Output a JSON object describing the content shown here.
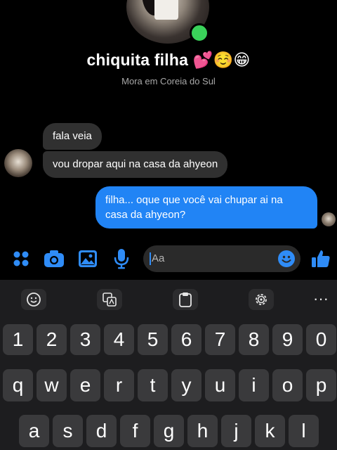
{
  "header": {
    "contact_name": "chiquita filha",
    "name_emojis": "💕☺️😁",
    "subtitle": "Mora em Coreia do Sul"
  },
  "messages": [
    {
      "direction": "incoming",
      "text": "fala veia"
    },
    {
      "direction": "incoming",
      "text": "vou dropar aqui na casa da ahyeon"
    },
    {
      "direction": "outgoing",
      "text": "filha... oque que você vai chupar ai na casa da ahyeon?"
    }
  ],
  "composer": {
    "placeholder": "Aa",
    "icons": [
      "menu-dots-icon",
      "camera-icon",
      "image-icon",
      "microphone-icon",
      "emoji-icon",
      "thumbs-up-icon"
    ]
  },
  "keyboard": {
    "toolbar_icons": [
      "emoji-smiley-icon",
      "translate-icon",
      "clipboard-icon",
      "settings-gear-icon",
      "more-icon"
    ],
    "more_label": "···",
    "row_numbers": [
      "1",
      "2",
      "3",
      "4",
      "5",
      "6",
      "7",
      "8",
      "9",
      "0"
    ],
    "row_top": [
      "q",
      "w",
      "e",
      "r",
      "t",
      "y",
      "u",
      "i",
      "o",
      "p"
    ],
    "row_middle": [
      "a",
      "s",
      "d",
      "f",
      "g",
      "h",
      "j",
      "k",
      "l"
    ]
  },
  "colors": {
    "accent": "#2f8cf7",
    "outgoing_bubble": "#2184f5",
    "incoming_bubble": "#303030",
    "online": "#3ad25a",
    "keyboard_bg": "#1d1d1f",
    "key_bg": "#3a3a3c"
  }
}
